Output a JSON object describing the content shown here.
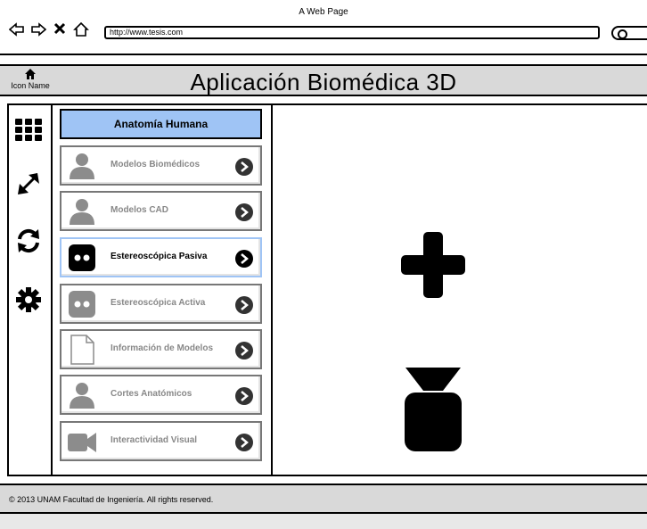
{
  "browser": {
    "window_title": "A Web Page",
    "url": "http://www.tesis.com",
    "nav_icons": [
      "back-arrow-icon",
      "forward-arrow-icon",
      "close-icon",
      "home-icon"
    ],
    "search_icon": "search-icon"
  },
  "header": {
    "home_label": "Icon Name",
    "title": "Aplicación Biomédica 3D",
    "background": "#d9d9d9"
  },
  "sidebar": {
    "icons": [
      "grid-icon",
      "expand-icon",
      "refresh-icon",
      "gear-icon"
    ]
  },
  "menu": {
    "header": "Anatomía Humana",
    "header_color": "#9fc4f5",
    "items": [
      {
        "label": "Modelos Biomédicos",
        "icon": "user-icon",
        "active": false
      },
      {
        "label": "Modelos  CAD",
        "icon": "user-icon",
        "active": false
      },
      {
        "label": "Estereoscópica Pasiva",
        "icon": "stereo-icon",
        "active": true
      },
      {
        "label": "Estereoscópica Activa",
        "icon": "stereo-icon",
        "active": false
      },
      {
        "label": "Información de Modelos",
        "icon": "document-icon",
        "active": false
      },
      {
        "label": "Cortes Anatómicos",
        "icon": "user-icon",
        "active": false
      },
      {
        "label": "Interactividad Visual",
        "icon": "video-camera-icon",
        "active": false
      }
    ]
  },
  "canvas": {
    "icons": [
      "plus-icon",
      "weight-icon"
    ]
  },
  "footer": {
    "text": "© 2013 UNAM Facultad de Ingeniería. All rights reserved."
  }
}
